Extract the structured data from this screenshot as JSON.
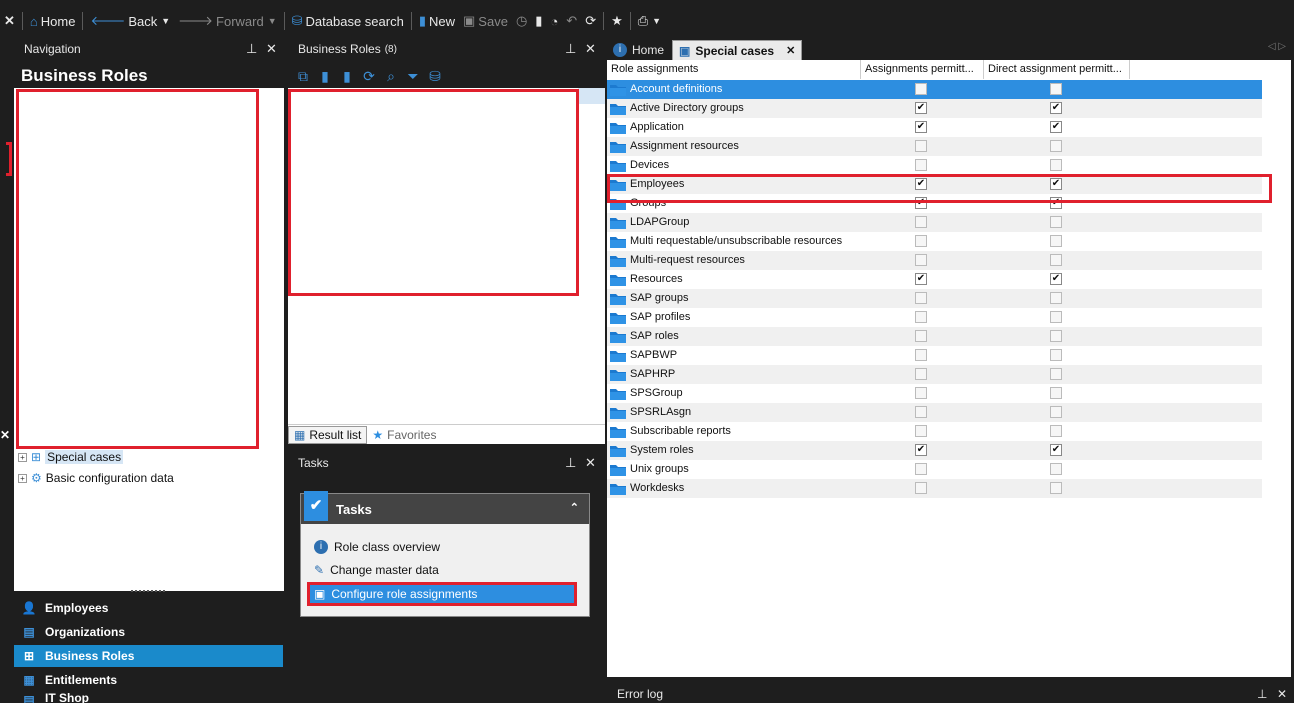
{
  "toolbar": {
    "home": "Home",
    "back": "Back",
    "forward": "Forward",
    "database_search": "Database search",
    "new": "New",
    "save": "Save"
  },
  "navigation": {
    "header": "Navigation",
    "title": "Business Roles",
    "tree": [
      {
        "label": "Special cases"
      },
      {
        "label": "Basic configuration data"
      }
    ],
    "buttons": [
      {
        "label": "Employees"
      },
      {
        "label": "Organizations"
      },
      {
        "label": "Business Roles"
      },
      {
        "label": "Entitlements"
      },
      {
        "label": "IT Shop"
      }
    ]
  },
  "business_roles": {
    "header": "Business Roles",
    "count": "(8)",
    "tabs": {
      "result_list": "Result list",
      "favorites": "Favorites"
    }
  },
  "tasks": {
    "header": "Tasks",
    "box_title": "Tasks",
    "items": [
      {
        "label": "Role class overview"
      },
      {
        "label": "Change master data"
      },
      {
        "label": "Configure role assignments"
      }
    ]
  },
  "doc_tabs": {
    "home": "Home",
    "special_cases": "Special cases"
  },
  "grid": {
    "columns": [
      "Role assignments",
      "Assignments permitt...",
      "Direct assignment permitt..."
    ],
    "rows": [
      {
        "name": "Account definitions",
        "a": false,
        "d": false
      },
      {
        "name": "Active Directory groups",
        "a": true,
        "d": true
      },
      {
        "name": "Application",
        "a": true,
        "d": true
      },
      {
        "name": "Assignment resources",
        "a": false,
        "d": false
      },
      {
        "name": "Devices",
        "a": false,
        "d": false
      },
      {
        "name": "Employees",
        "a": true,
        "d": true
      },
      {
        "name": "Groups",
        "a": true,
        "d": true
      },
      {
        "name": "LDAPGroup",
        "a": false,
        "d": false
      },
      {
        "name": "Multi requestable/unsubscribable resources",
        "a": false,
        "d": false
      },
      {
        "name": "Multi-request resources",
        "a": false,
        "d": false
      },
      {
        "name": "Resources",
        "a": true,
        "d": true
      },
      {
        "name": "SAP groups",
        "a": false,
        "d": false
      },
      {
        "name": "SAP profiles",
        "a": false,
        "d": false
      },
      {
        "name": "SAP roles",
        "a": false,
        "d": false
      },
      {
        "name": "SAPBWP",
        "a": false,
        "d": false
      },
      {
        "name": "SAPHRP",
        "a": false,
        "d": false
      },
      {
        "name": "SPSGroup",
        "a": false,
        "d": false
      },
      {
        "name": "SPSRLAsgn",
        "a": false,
        "d": false
      },
      {
        "name": "Subscribable reports",
        "a": false,
        "d": false
      },
      {
        "name": "System roles",
        "a": true,
        "d": true
      },
      {
        "name": "Unix groups",
        "a": false,
        "d": false
      },
      {
        "name": "Workdesks",
        "a": false,
        "d": false
      }
    ]
  },
  "error_log": {
    "header": "Error log"
  },
  "colors": {
    "accent": "#1a8acb",
    "highlight": "#e0202d",
    "selection": "#2d8ee0"
  }
}
